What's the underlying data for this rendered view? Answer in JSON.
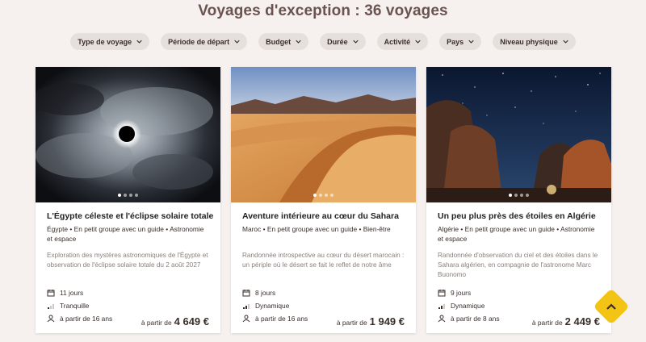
{
  "header": {
    "title": "Voyages d'exception : 36 voyages"
  },
  "filters": [
    {
      "label": "Type de voyage"
    },
    {
      "label": "Période de départ"
    },
    {
      "label": "Budget"
    },
    {
      "label": "Durée"
    },
    {
      "label": "Activité"
    },
    {
      "label": "Pays"
    },
    {
      "label": "Niveau physique"
    }
  ],
  "cards": [
    {
      "title": "L'Égypte céleste et l'éclipse solaire totale",
      "tags": "Égypte • En petit groupe avec un guide • Astronomie et espace",
      "description": "Exploration des mystères astronomiques de l'Égypte et observation de l'éclipse solaire totale du 2 août 2027",
      "duration": "11 jours",
      "level": "Tranquille",
      "age": "à partir de 16 ans",
      "price_prefix": "à partir de",
      "price": "4 649 €"
    },
    {
      "title": "Aventure intérieure au cœur du Sahara",
      "tags": "Maroc • En petit groupe avec un guide • Bien-être",
      "description": "Randonnée introspective au cœur du désert marocain : un périple où le désert se fait le reflet de notre âme",
      "duration": "8 jours",
      "level": "Dynamique",
      "age": "à partir de 16 ans",
      "price_prefix": "à partir de",
      "price": "1 949 €"
    },
    {
      "title": "Un peu plus près des étoiles en Algérie",
      "tags": "Algérie • En petit groupe avec un guide • Astronomie et espace",
      "description": "Randonnée d'observation du ciel et des étoiles dans le Sahara algérien, en compagnie de l'astronome Marc Buonomo",
      "duration": "9 jours",
      "level": "Dynamique",
      "age": "à partir de 8 ans",
      "price_prefix": "à partir de",
      "price": "2 449 €"
    }
  ],
  "colors": {
    "background": "#f6f1ee",
    "title": "#6a5350",
    "chip": "#e6e0dd",
    "scroll_top": "#f3c414"
  },
  "icons": [
    "chevron-down-icon",
    "calendar-icon",
    "signal-level-icon",
    "person-icon",
    "chevron-up-icon"
  ]
}
